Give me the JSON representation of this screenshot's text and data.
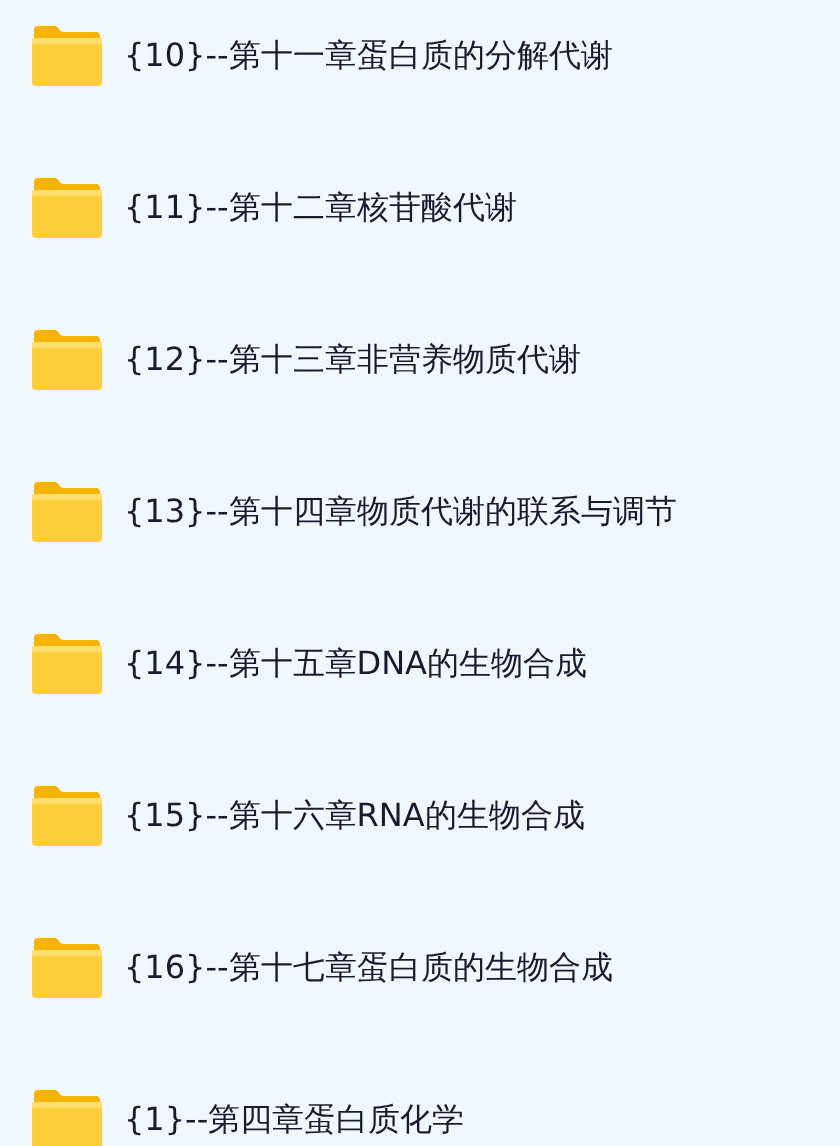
{
  "folders": [
    {
      "name": "{10}--第十一章蛋白质的分解代谢"
    },
    {
      "name": "{11}--第十二章核苷酸代谢"
    },
    {
      "name": "{12}--第十三章非营养物质代谢"
    },
    {
      "name": "{13}--第十四章物质代谢的联系与调节"
    },
    {
      "name": "{14}--第十五章DNA的生物合成"
    },
    {
      "name": "{15}--第十六章RNA的生物合成"
    },
    {
      "name": "{16}--第十七章蛋白质的生物合成"
    },
    {
      "name": "{1}--第四章蛋白质化学"
    }
  ]
}
